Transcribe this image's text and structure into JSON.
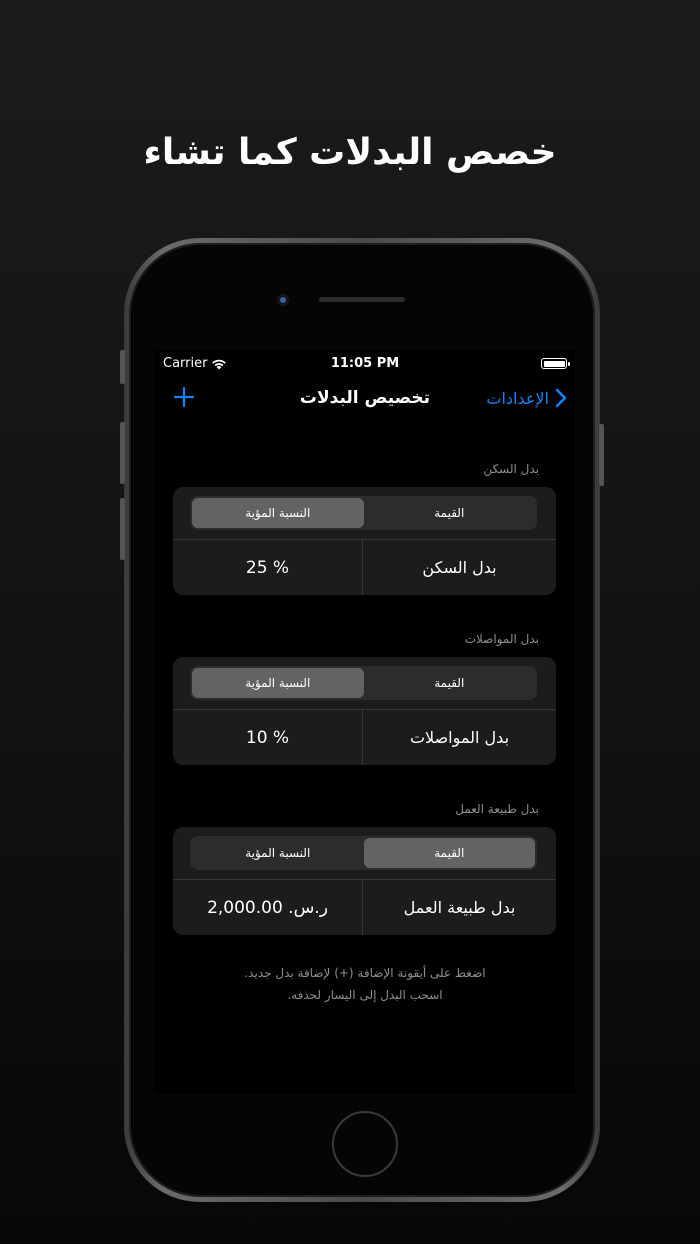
{
  "headline": "خصص البدلات كما تشاء",
  "status_bar": {
    "carrier": "Carrier",
    "time": "11:05 PM"
  },
  "nav": {
    "title": "تخصيص البدلات",
    "back_label": "الإعدادات",
    "add_icon": "plus-icon",
    "back_icon": "chevron-right-icon"
  },
  "accent_color": "#0a84ff",
  "sections": [
    {
      "header": "بدل السكن",
      "segments": [
        "القيمة",
        "النسبة المؤية"
      ],
      "selected_segment": "النسبة المؤية",
      "label": "بدل السكن",
      "value": "25 %"
    },
    {
      "header": "بدل المواصلات",
      "segments": [
        "القيمة",
        "النسبة المؤية"
      ],
      "selected_segment": "النسبة المؤية",
      "label": "بدل المواصلات",
      "value": "10 %"
    },
    {
      "header": "بدل طبيعة العمل",
      "segments": [
        "القيمة",
        "النسبة المؤية"
      ],
      "selected_segment": "القيمة",
      "label": "بدل طبيعة العمل",
      "value": "ر.س. 2,000.00"
    }
  ],
  "footer": {
    "line1": "اضغط على أيقونة الإضافة (+) لإضافة بدل جديد.",
    "line2": "اسحب البدل إلى اليسار لحذفه."
  }
}
